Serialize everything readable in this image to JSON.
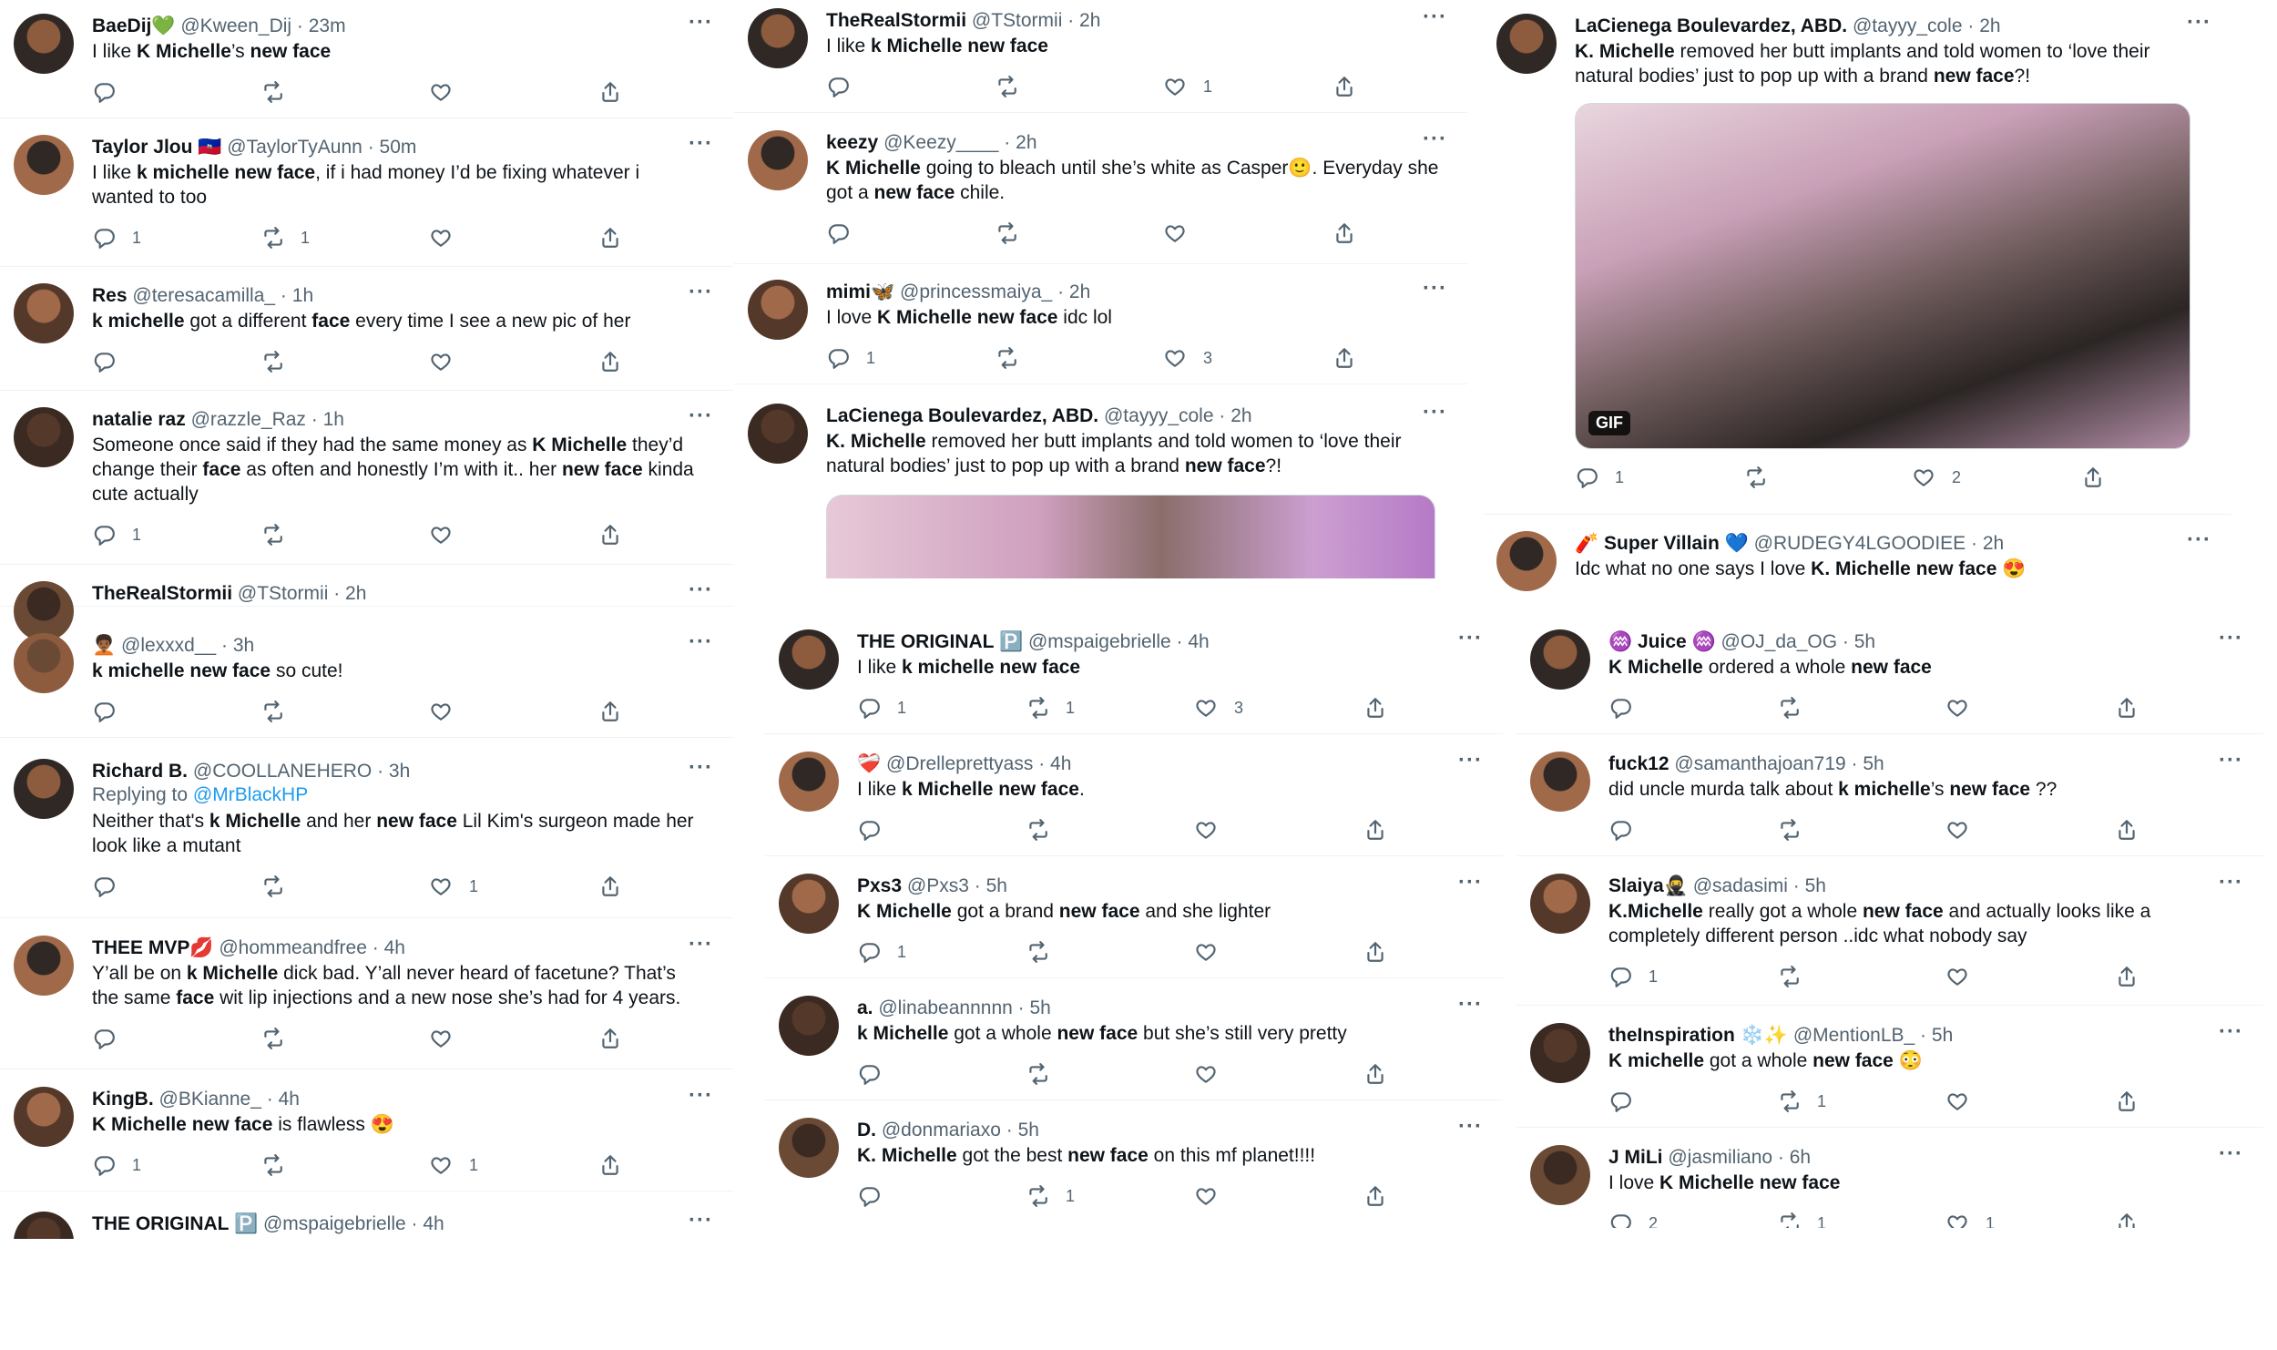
{
  "colors": {
    "text": "#0f1419",
    "secondary": "#536471",
    "link": "#1d9bf0",
    "divider": "#eff3f4"
  },
  "icons": {
    "reply": "reply-icon",
    "retweet": "retweet-icon",
    "like": "heart-icon",
    "share": "share-icon",
    "more": "more-icon"
  },
  "more_label": "···",
  "p1": [
    {
      "name": "BaeDij💚",
      "handle": "@Kween_Dij",
      "time": "23m",
      "segs": [
        [
          "I like ",
          0
        ],
        [
          "K Michelle",
          1
        ],
        [
          "’s ",
          0
        ],
        [
          "new face",
          1
        ]
      ],
      "counts": [
        "",
        "",
        "",
        ""
      ]
    },
    {
      "name": "Taylor Jlou 🇭🇹",
      "handle": "@TaylorTyAunn",
      "time": "50m",
      "segs": [
        [
          "I like ",
          0
        ],
        [
          "k michelle new face",
          1
        ],
        [
          ", if i had money I’d be fixing whatever i wanted to too",
          0
        ]
      ],
      "counts": [
        "1",
        "1",
        "",
        ""
      ]
    },
    {
      "name": "Res",
      "handle": "@teresacamilla_",
      "time": "1h",
      "segs": [
        [
          "k michelle",
          1
        ],
        [
          " got a different ",
          0
        ],
        [
          "face",
          1
        ],
        [
          " every time I see a new pic of her",
          0
        ]
      ],
      "counts": [
        "",
        "",
        "",
        ""
      ]
    },
    {
      "name": "natalie raz",
      "handle": "@razzle_Raz",
      "time": "1h",
      "segs": [
        [
          "Someone once said if they had the same money as ",
          0
        ],
        [
          "K Michelle",
          1
        ],
        [
          " they’d change their ",
          0
        ],
        [
          "face",
          1
        ],
        [
          " as often and honestly I’m with it.. her ",
          0
        ],
        [
          "new face",
          1
        ],
        [
          " kinda cute actually",
          0
        ]
      ],
      "counts": [
        "1",
        "",
        "",
        ""
      ]
    },
    {
      "name": "TheRealStormii",
      "handle": "@TStormii",
      "time": "2h",
      "segs": [],
      "counts": []
    },
    {
      "name": "🧑🏾‍🦱",
      "handle": "@lexxxd__",
      "time": "3h",
      "segs": [
        [
          "k michelle new face",
          1
        ],
        [
          " so cute!",
          0
        ]
      ],
      "counts": [
        "",
        "",
        "",
        ""
      ]
    },
    {
      "name": "Richard B.",
      "handle": "@COOLLANEHERO",
      "time": "3h",
      "reply_label": "Replying to",
      "reply_to": "@MrBlackHP",
      "segs": [
        [
          "Neither that's ",
          0
        ],
        [
          "k Michelle",
          1
        ],
        [
          " and her ",
          0
        ],
        [
          "new face",
          1
        ],
        [
          " Lil Kim's surgeon made her look like a mutant",
          0
        ]
      ],
      "counts": [
        "",
        "",
        "1",
        ""
      ]
    },
    {
      "name": "THEE MVP💋",
      "handle": "@hommeandfree",
      "time": "4h",
      "segs": [
        [
          "Y’all be on ",
          0
        ],
        [
          "k Michelle",
          1
        ],
        [
          " dick bad. Y’all never heard of facetune? That’s the same ",
          0
        ],
        [
          "face",
          1
        ],
        [
          " wit lip injections and a new nose she’s had for 4 years.",
          0
        ]
      ],
      "counts": [
        "",
        "",
        "",
        ""
      ]
    },
    {
      "name": "KingB.",
      "handle": "@BKianne_",
      "time": "4h",
      "segs": [
        [
          "K Michelle new face",
          1
        ],
        [
          " is flawless 😍",
          0
        ]
      ],
      "counts": [
        "1",
        "",
        "1",
        ""
      ]
    },
    {
      "name": "THE ORIGINAL 🅿️",
      "handle": "@mspaigebrielle",
      "time": "4h",
      "segs": [],
      "counts": []
    }
  ],
  "p2": [
    {
      "name": "TheRealStormii",
      "handle": "@TStormii",
      "time": "2h",
      "segs": [
        [
          "I like ",
          0
        ],
        [
          "k Michelle new face",
          1
        ]
      ],
      "counts": [
        "",
        "",
        "1",
        ""
      ]
    },
    {
      "name": "keezy",
      "handle": "@Keezy____",
      "time": "2h",
      "segs": [
        [
          "K Michelle",
          1
        ],
        [
          " going to bleach until she’s white as Casper🙂. Everyday she got a ",
          0
        ],
        [
          "new face",
          1
        ],
        [
          " chile.",
          0
        ]
      ],
      "counts": [
        "",
        "",
        "",
        ""
      ]
    },
    {
      "name": "mimi🦋",
      "handle": "@princessmaiya_",
      "time": "2h",
      "segs": [
        [
          "I love ",
          0
        ],
        [
          "K Michelle new face",
          1
        ],
        [
          " idc lol",
          0
        ]
      ],
      "counts": [
        "1",
        "",
        "3",
        ""
      ]
    },
    {
      "name": "LaCienega Boulevardez, ABD.",
      "handle": "@tayyy_cole",
      "time": "2h",
      "segs": [
        [
          "K. Michelle",
          1
        ],
        [
          " removed her butt implants and told women to ‘love their natural bodies’ just to pop up with a brand ",
          0
        ],
        [
          "new face",
          1
        ],
        [
          "?!",
          0
        ]
      ],
      "counts": []
    }
  ],
  "p3": [
    {
      "name": "LaCienega Boulevardez, ABD.",
      "handle": "@tayyy_cole",
      "time": "2h",
      "segs": [
        [
          "K. Michelle",
          1
        ],
        [
          " removed her butt implants and told women to ‘love their natural bodies’ just to pop up with a brand ",
          0
        ],
        [
          "new face",
          1
        ],
        [
          "?!",
          0
        ]
      ],
      "gif": "GIF",
      "counts": [
        "1",
        "",
        "2",
        ""
      ]
    },
    {
      "name": "🧨 Super Villain 💙",
      "handle": "@RUDEGY4LGOODIEE",
      "time": "2h",
      "segs": [
        [
          "Idc what no one says I love ",
          0
        ],
        [
          "K. Michelle new face",
          1
        ],
        [
          " 😍",
          0
        ]
      ],
      "counts": []
    }
  ],
  "p4": [
    {
      "name": "THE ORIGINAL 🅿️",
      "handle": "@mspaigebrielle",
      "time": "4h",
      "segs": [
        [
          "I like ",
          0
        ],
        [
          "k michelle new face",
          1
        ]
      ],
      "counts": [
        "1",
        "1",
        "3",
        ""
      ]
    },
    {
      "name": "❤️‍🩹",
      "handle": "@Drelleprettyass",
      "time": "4h",
      "segs": [
        [
          "I like ",
          0
        ],
        [
          "k Michelle new face",
          1
        ],
        [
          ".",
          0
        ]
      ],
      "counts": [
        "",
        "",
        "",
        ""
      ]
    },
    {
      "name": "Pxs3",
      "handle": "@Pxs3",
      "time": "5h",
      "segs": [
        [
          "K Michelle",
          1
        ],
        [
          " got a brand ",
          0
        ],
        [
          "new face",
          1
        ],
        [
          " and she lighter",
          0
        ]
      ],
      "counts": [
        "1",
        "",
        "",
        ""
      ]
    },
    {
      "name": "a.",
      "handle": "@linabeannnnn",
      "time": "5h",
      "segs": [
        [
          "k Michelle",
          1
        ],
        [
          " got a whole ",
          0
        ],
        [
          "new face",
          1
        ],
        [
          " but she’s still very pretty",
          0
        ]
      ],
      "counts": [
        "",
        "",
        "",
        ""
      ]
    },
    {
      "name": "D.",
      "handle": "@donmariaxo",
      "time": "5h",
      "segs": [
        [
          "K. Michelle",
          1
        ],
        [
          " got the best ",
          0
        ],
        [
          "new face",
          1
        ],
        [
          " on this mf planet!!!!",
          0
        ]
      ],
      "counts": [
        "",
        "1",
        "",
        ""
      ]
    }
  ],
  "p5": [
    {
      "name": "♒ Juice ♒",
      "handle": "@OJ_da_OG",
      "time": "5h",
      "segs": [
        [
          "K Michelle",
          1
        ],
        [
          " ordered a whole ",
          0
        ],
        [
          "new face",
          1
        ]
      ],
      "counts": [
        "",
        "",
        "",
        ""
      ]
    },
    {
      "name": "fuck12",
      "handle": "@samanthajoan719",
      "time": "5h",
      "segs": [
        [
          "did uncle murda talk about ",
          0
        ],
        [
          "k michelle",
          1
        ],
        [
          "’s ",
          0
        ],
        [
          "new face",
          1
        ],
        [
          " ??",
          0
        ]
      ],
      "counts": [
        "",
        "",
        "",
        ""
      ]
    },
    {
      "name": "Slaiya🥷",
      "handle": "@sadasimi",
      "time": "5h",
      "segs": [
        [
          "K.Michelle",
          1
        ],
        [
          " really got a whole ",
          0
        ],
        [
          "new face",
          1
        ],
        [
          " and actually looks like a completely different person ..idc what nobody say",
          0
        ]
      ],
      "counts": [
        "1",
        "",
        "",
        ""
      ]
    },
    {
      "name": "theInspiration ❄️✨",
      "handle": "@MentionLB_",
      "time": "5h",
      "segs": [
        [
          "K michelle",
          1
        ],
        [
          " got a whole ",
          0
        ],
        [
          "new face",
          1
        ],
        [
          " 😳",
          0
        ]
      ],
      "counts": [
        "",
        "1",
        "",
        ""
      ]
    },
    {
      "name": "J MiLi",
      "handle": "@jasmiliano",
      "time": "6h",
      "segs": [
        [
          "I love ",
          0
        ],
        [
          "K Michelle new face",
          1
        ]
      ],
      "counts": [
        "2",
        "1",
        "1",
        ""
      ]
    }
  ]
}
